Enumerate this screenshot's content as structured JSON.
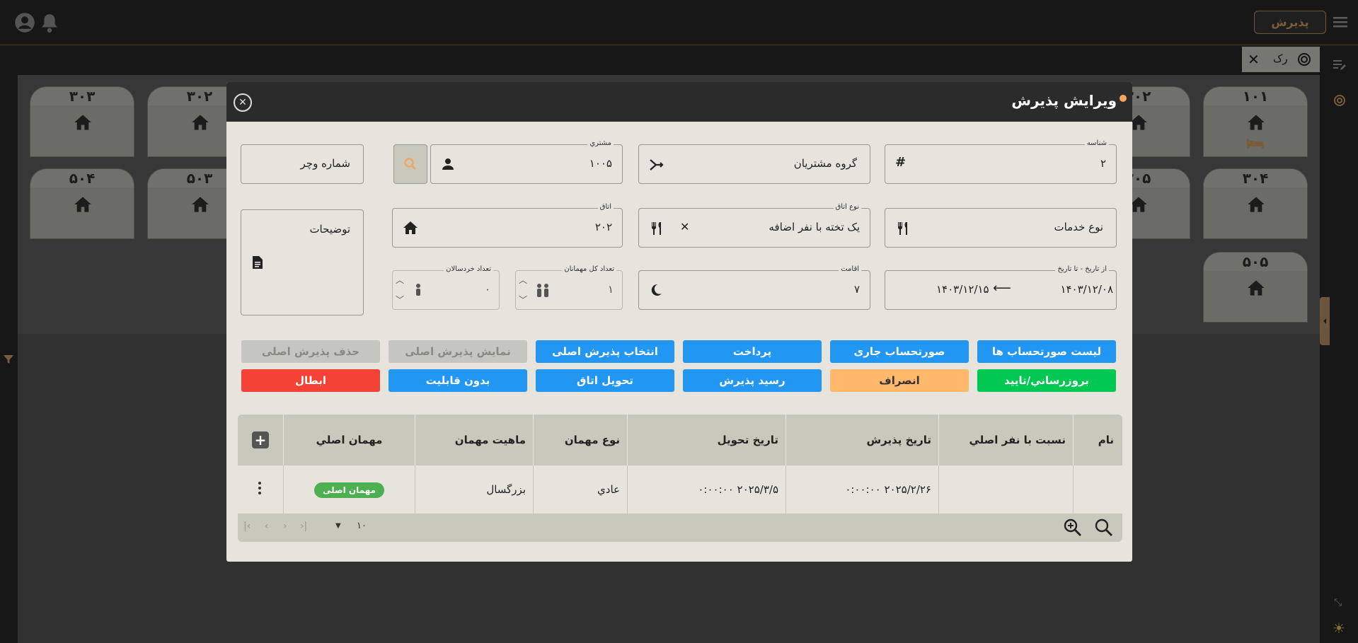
{
  "header": {
    "reception_button": "پذیرش"
  },
  "tabbar": {
    "tab_label": "رک"
  },
  "rooms": [
    {
      "num": "۳۰۳",
      "bed": false
    },
    {
      "num": "۳۰۲",
      "bed": false
    },
    {
      "num": "۳۰۲",
      "bed": false
    },
    {
      "num": "۱۰۱",
      "bed": true
    },
    {
      "num": "۵۰۴",
      "bed": false
    },
    {
      "num": "۵۰۳",
      "bed": false
    },
    {
      "num": "۲۰۵",
      "bed": false
    },
    {
      "num": "۳۰۴",
      "bed": false
    },
    {
      "num": "۵۰۵",
      "bed": false
    }
  ],
  "modal": {
    "title": "ویرایش پذیرش",
    "fields": {
      "id": {
        "label": "شناسه",
        "value": "۲"
      },
      "customer_group": {
        "placeholder": "گروه مشتریان"
      },
      "customer": {
        "label": "مشتري",
        "value": "۱۰۰۵"
      },
      "voucher": {
        "placeholder": "شماره وچر"
      },
      "service_type": {
        "placeholder": "نوع خدمات"
      },
      "room_type": {
        "label": "نوع اتاق",
        "value": "یک تخته با نفر اضافه"
      },
      "room": {
        "label": "اتاق",
        "value": "۲۰۲"
      },
      "notes": {
        "placeholder": "توضیحات"
      },
      "date_range": {
        "label": "از تاریخ - تا تاریخ",
        "from": "۱۴۰۳/۱۲/۰۸",
        "to": "۱۴۰۳/۱۲/۱۵"
      },
      "stay": {
        "label": "اقامت",
        "value": "۷"
      },
      "total_guests": {
        "label": "تعداد کل مهمانان",
        "value": "۱"
      },
      "children": {
        "label": "تعداد خردسالان",
        "value": "۰"
      }
    },
    "buttons": {
      "invoice_list": "لیست صورتحساب ها",
      "current_invoice": "صورتحساب جاری",
      "payment": "پرداخت",
      "select_main": "انتخاب پذیرش اصلی",
      "show_main": "نمایش پذیرش اصلی",
      "delete_main": "حذف پذیرش اصلی",
      "update_confirm": "بروزرساني/تایید",
      "cancel": "انصراف",
      "receipt": "رسید پذیرش",
      "room_delivery": "تحویل اتاق",
      "no_capability": "بدون قابلیت",
      "void": "ابطال"
    },
    "table": {
      "columns": [
        "نام",
        "نسبت با نفر اصلي",
        "تاریخ پذیرش",
        "تاریخ تحویل",
        "نوع مهمان",
        "ماهیت مهمان",
        "مهمان اصلي"
      ],
      "rows": [
        {
          "name": "",
          "relation": "",
          "checkin": "۲۰۲۵/۲/۲۶ ۰:۰۰:۰۰",
          "checkout": "۲۰۲۵/۳/۵ ۰:۰۰:۰۰",
          "guest_type": "عادي",
          "guest_nature": "بزرگسال",
          "main_guest": "مهمان اصلی"
        }
      ],
      "page_size": "۱۰"
    }
  },
  "colors": {
    "accent": "#2196f3",
    "success": "#00c853",
    "warning": "#ffb86c",
    "danger": "#f44336",
    "brand": "#c69c6d"
  }
}
